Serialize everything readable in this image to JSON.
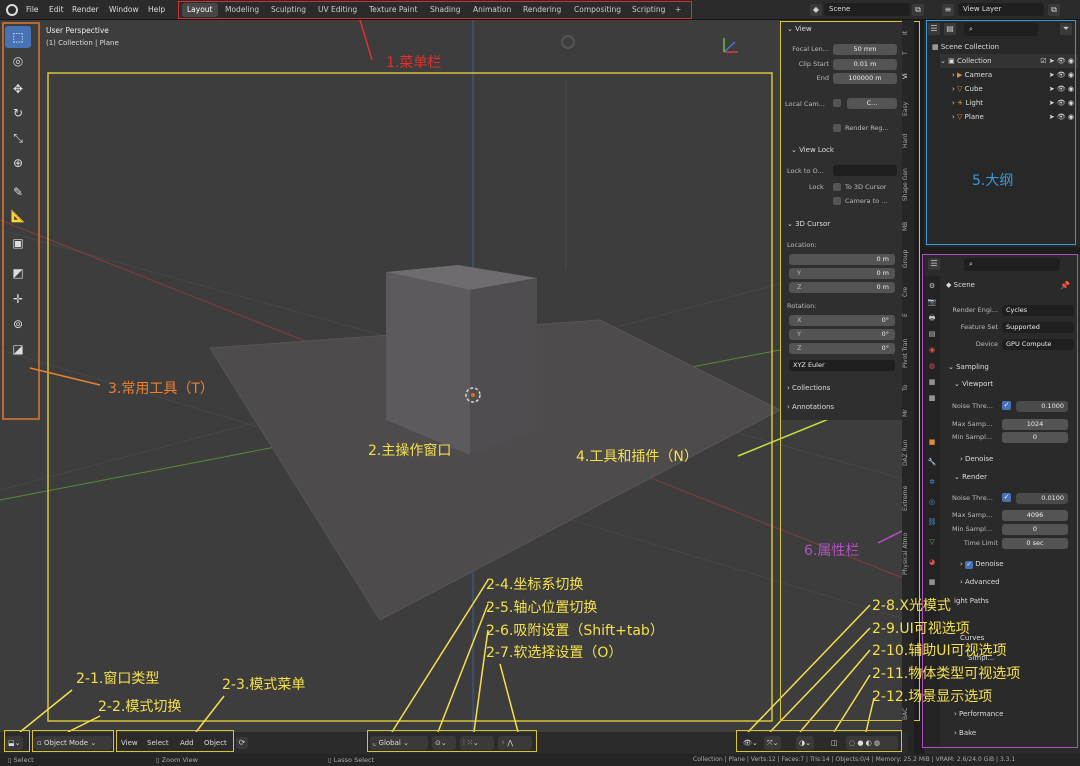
{
  "topbar": {
    "menus": [
      "File",
      "Edit",
      "Render",
      "Window",
      "Help"
    ],
    "workspaces": [
      "Layout",
      "Modeling",
      "Sculpting",
      "UV Editing",
      "Texture Paint",
      "Shading",
      "Animation",
      "Rendering",
      "Compositing",
      "Scripting",
      "+"
    ],
    "active_workspace": "Layout",
    "scene": "Scene",
    "view_layer": "View Layer"
  },
  "viewport": {
    "title": "User Perspective",
    "subtitle": "(1) Collection | Plane"
  },
  "npanel": {
    "view_head": "View",
    "focal_label": "Focal Len...",
    "focal_value": "50 mm",
    "clip_start_label": "Clip Start",
    "clip_start_value": "0.01 m",
    "end_label": "End",
    "end_value": "100000 m",
    "local_cam_label": "Local Cam...",
    "local_cam_value": "C...",
    "render_reg": "Render Reg...",
    "viewlock_head": "View Lock",
    "lock_to_label": "Lock to O...",
    "lock_label": "Lock",
    "to_3d_cursor": "To 3D Cursor",
    "camera_to": "Camera to ...",
    "cursor_head": "3D Cursor",
    "location_label": "Location:",
    "rotation_label": "Rotation:",
    "loc": [
      {
        "axis": "X",
        "value": "0 m"
      },
      {
        "axis": "Y",
        "value": "0 m"
      },
      {
        "axis": "Z",
        "value": "0 m"
      }
    ],
    "rot": [
      {
        "axis": "X",
        "value": "0°"
      },
      {
        "axis": "Y",
        "value": "0°"
      },
      {
        "axis": "Z",
        "value": "0°"
      }
    ],
    "rot_mode": "XYZ Euler",
    "collections": "Collections",
    "annotations": "Annotations",
    "tabs": [
      "It",
      "T",
      "Vi",
      "Easy",
      "Hard",
      "Shape Gen",
      "MB",
      "Group",
      "Cre",
      "E",
      "Pivot Tran",
      "To",
      "Mr",
      "DAZ Run",
      "Extreme",
      "Physical Atmo",
      "BAC"
    ]
  },
  "outliner": {
    "scene_collection": "Scene Collection",
    "collection": "Collection",
    "items": [
      "Camera",
      "Cube",
      "Light",
      "Plane"
    ]
  },
  "props": {
    "scene": "Scene",
    "render_engine_label": "Render Engi...",
    "render_engine": "Cycles",
    "feature_set_label": "Feature Set",
    "feature_set": "Supported",
    "device_label": "Device",
    "device": "GPU Compute",
    "sampling": "Sampling",
    "viewport": "Viewport",
    "noise_thr_label": "Noise Thre...",
    "vp_noise": "0.1000",
    "max_samp_label": "Max Samp...",
    "vp_max": "1024",
    "min_samp_label": "Min Sampl...",
    "vp_min": "0",
    "denoise": "Denoise",
    "render": "Render",
    "r_noise": "0.0100",
    "r_max": "4096",
    "r_min": "0",
    "time_limit_label": "Time Limit",
    "time_limit": "0 sec",
    "advanced": "Advanced",
    "light_paths": "ight Paths",
    "curves": "Curves",
    "simplify": "Simpl...",
    "performance": "Performance",
    "bake": "Bake"
  },
  "header": {
    "object_mode": "Object Mode",
    "view": "View",
    "select": "Select",
    "add": "Add",
    "object": "Object",
    "global": "Global"
  },
  "status": {
    "select": "Select",
    "zoom": "Zoom View",
    "lasso": "Lasso Select",
    "stats": "Collection | Plane | Verts:12 | Faces:7 | Tris:14 | Objects:0/4 | Memory: 25.2 MiB | VRAM: 2.6/24.0 GiB | 3.3.1"
  },
  "annotations": {
    "menu_bar": "1.菜单栏",
    "main_window": "2.主操作窗口",
    "tools": "3.常用工具（T）",
    "tools_plugins": "4.工具和插件（N）",
    "outliner": "5.大纲",
    "properties": "6.属性栏",
    "a21": "2-1.窗口类型",
    "a22": "2-2.模式切换",
    "a23": "2-3.模式菜单",
    "a24": "2-4.坐标系切换",
    "a25": "2-5.轴心位置切换",
    "a26": "2-6.吸附设置（Shift+tab）",
    "a27": "2-7.软选择设置（O）",
    "a28": "2-8.X光模式",
    "a29": "2-9.UI可视选项",
    "a210": "2-10.辅助UI可视选项",
    "a211": "2-11.物体类型可视选项",
    "a212": "2-12.场景显示选项"
  },
  "colors": {
    "accent": "#4772b3",
    "annotation_yellow": "#f4e04d",
    "annotation_red": "#e03030",
    "annotation_orange": "#f08030",
    "annotation_blue": "#3a9ad9",
    "annotation_purple": "#b050c0"
  }
}
